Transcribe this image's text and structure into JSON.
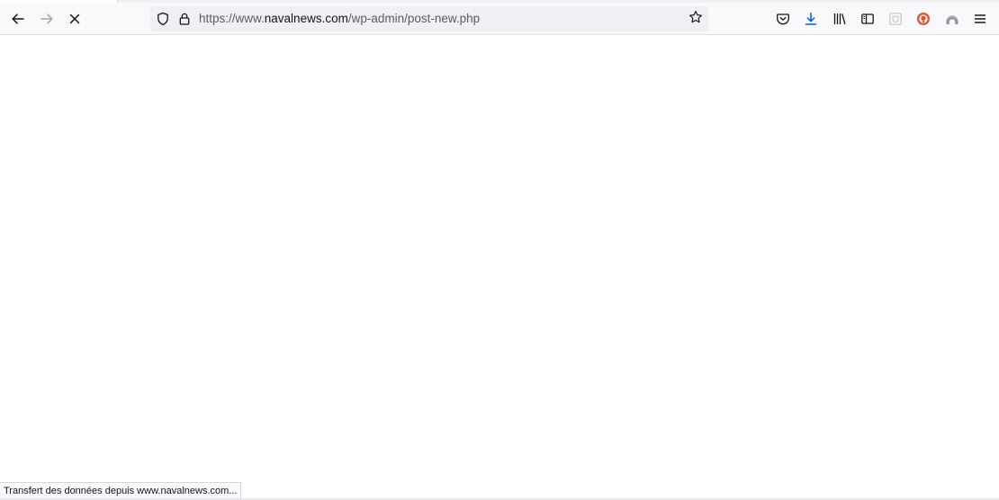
{
  "toolbar": {
    "url": {
      "prefix": "https://www.",
      "domain": "navalnews.com",
      "path": "/wp-admin/post-new.php"
    },
    "icons": {
      "back": "back-arrow-icon",
      "forward": "forward-arrow-icon",
      "stop": "stop-loading-icon",
      "tracking_protection": "shield-icon",
      "secure": "lock-icon",
      "bookmark": "star-icon",
      "pocket": "pocket-icon",
      "downloads": "download-icon",
      "library": "library-icon",
      "sidebar": "sidebar-icon",
      "extension": "extension-icon",
      "duckduckgo": "duckduckgo-icon",
      "account": "account-icon",
      "menu": "hamburger-menu-icon"
    },
    "colors": {
      "download_accent": "#0060df",
      "duckduckgo": "#de5833"
    }
  },
  "status": {
    "text": "Transfert des données depuis www.navalnews.com..."
  }
}
